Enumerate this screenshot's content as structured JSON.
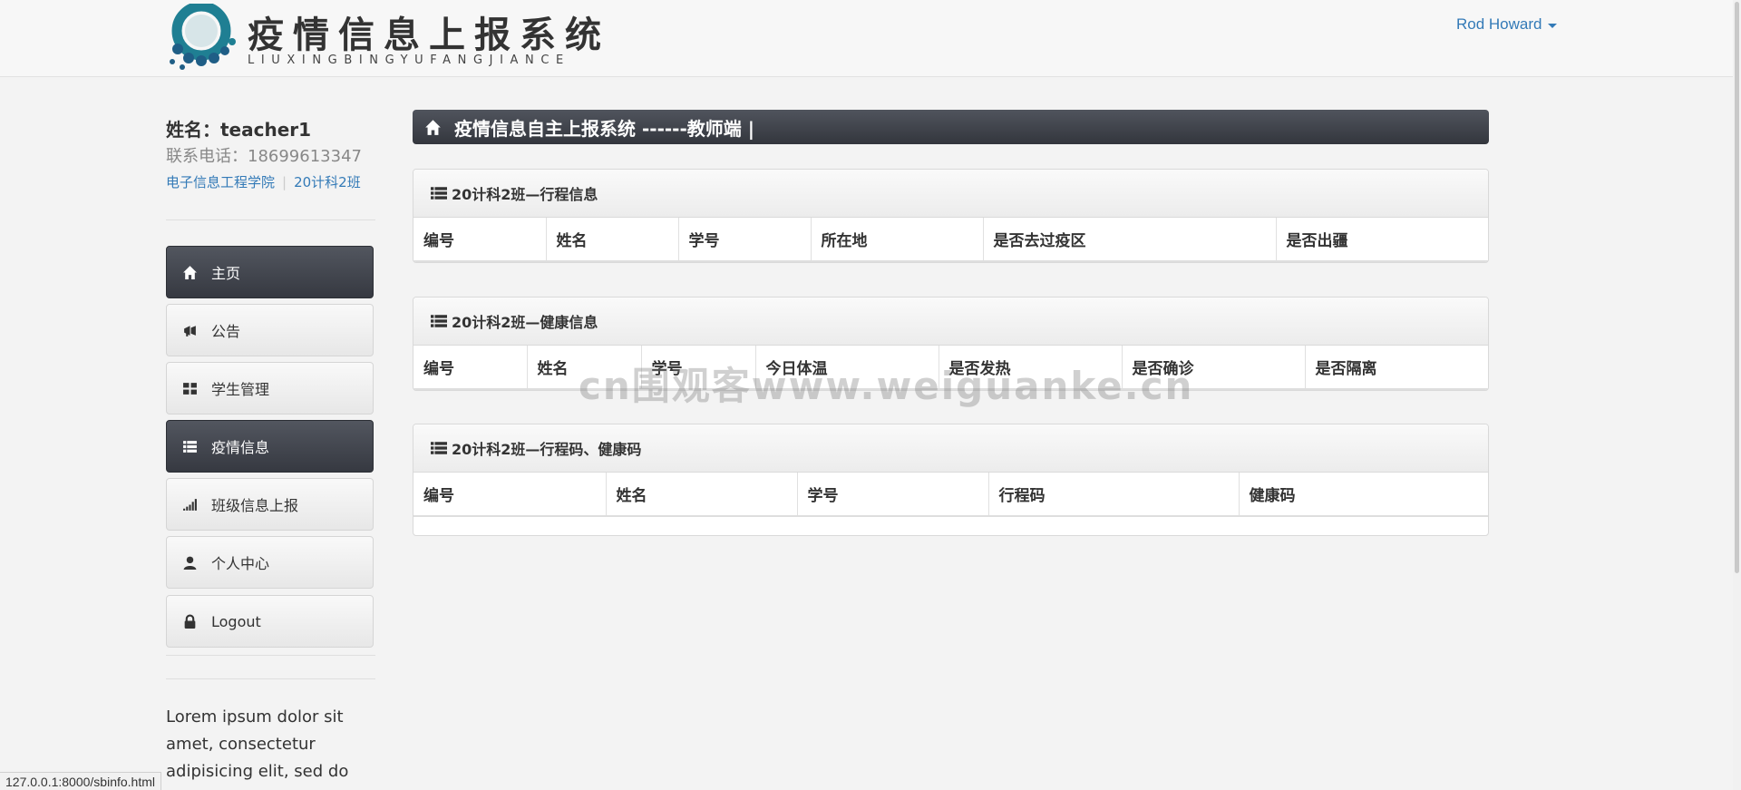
{
  "header": {
    "title": "疫情信息上报系统",
    "subtitle": "LIUXINGBINGYUFANGJIANCE",
    "user_name": "Rod Howard"
  },
  "profile": {
    "name": "姓名：teacher1",
    "phone": "联系电话：18699613347",
    "college": "电子信息工程学院",
    "class_name": "20计科2班"
  },
  "nav": [
    {
      "label": "主页",
      "icon": "home-icon",
      "active": true
    },
    {
      "label": "公告",
      "icon": "megaphone-icon",
      "active": false
    },
    {
      "label": "学生管理",
      "icon": "grid-icon",
      "active": false
    },
    {
      "label": "疫情信息",
      "icon": "list-icon",
      "active": true
    },
    {
      "label": "班级信息上报",
      "icon": "signal-icon",
      "active": false
    },
    {
      "label": "个人中心",
      "icon": "user-icon",
      "active": false
    },
    {
      "label": "Logout",
      "icon": "lock-icon",
      "active": false
    }
  ],
  "sidebar_text": "Lorem ipsum dolor sit amet, consectetur adipisicing elit, sed do",
  "page_heading": "疫情信息自主上报系统 ------教师端 |",
  "panels": [
    {
      "title": "20计科2班—行程信息",
      "columns": [
        "编号",
        "姓名",
        "学号",
        "所在地",
        "是否去过疫区",
        "是否出疆"
      ]
    },
    {
      "title": "20计科2班—健康信息",
      "columns": [
        "编号",
        "姓名",
        "学号",
        "今日体温",
        "是否发热",
        "是否确诊",
        "是否隔离"
      ]
    },
    {
      "title": "20计科2班—行程码、健康码",
      "columns": [
        "编号",
        "姓名",
        "学号",
        "行程码",
        "健康码"
      ]
    }
  ],
  "watermark": "cn围观客www.weiguanke.cn",
  "status_url": "127.0.0.1:8000/sbinfo.html"
}
